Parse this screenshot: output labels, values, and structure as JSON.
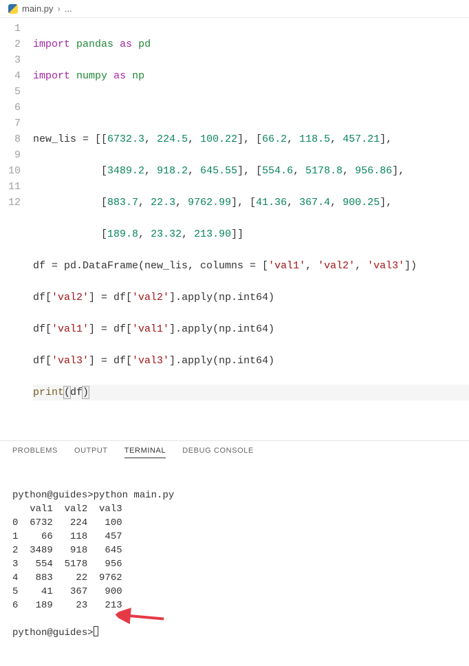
{
  "breadcrumb": {
    "file": "main.py",
    "more": "..."
  },
  "gutter_lines": [
    "1",
    "2",
    "3",
    "4",
    "5",
    "6",
    "7",
    "8",
    "9",
    "10",
    "11",
    "12"
  ],
  "code": {
    "l1": {
      "import": "import",
      "mod": "pandas",
      "as": "as",
      "alias": "pd"
    },
    "l2": {
      "import": "import",
      "mod": "numpy",
      "as": "as",
      "alias": "np"
    },
    "l4_a": "new_lis = [[",
    "l4_nums": [
      "6732.3",
      "224.5",
      "100.22"
    ],
    "l4_b": "], [",
    "l4_nums2": [
      "66.2",
      "118.5",
      "457.21"
    ],
    "l4_c": "],",
    "l5_a": "           [",
    "l5_nums": [
      "3489.2",
      "918.2",
      "645.55"
    ],
    "l5_b": "], [",
    "l5_nums2": [
      "554.6",
      "5178.8",
      "956.86"
    ],
    "l5_c": "],",
    "l6_a": "           [",
    "l6_nums": [
      "883.7",
      "22.3",
      "9762.99"
    ],
    "l6_b": "], [",
    "l6_nums2": [
      "41.36",
      "367.4",
      "900.25"
    ],
    "l6_c": "],",
    "l7_a": "           [",
    "l7_nums": [
      "189.8",
      "23.32",
      "213.90"
    ],
    "l7_b": "]]",
    "l8_a": "df = pd.DataFrame(new_lis, columns = [",
    "l8_strs": [
      "'val1'",
      "'val2'",
      "'val3'"
    ],
    "l8_b": "])",
    "l9_a": "df[",
    "l9_s1": "'val2'",
    "l9_b": "] = df[",
    "l9_s2": "'val2'",
    "l9_c": "].apply(np.int64)",
    "l10_a": "df[",
    "l10_s1": "'val1'",
    "l10_b": "] = df[",
    "l10_s2": "'val1'",
    "l10_c": "].apply(np.int64)",
    "l11_a": "df[",
    "l11_s1": "'val3'",
    "l11_b": "] = df[",
    "l11_s2": "'val3'",
    "l11_c": "].apply(np.int64)",
    "l12_print": "print",
    "l12_a": "(",
    "l12_df": "df",
    "l12_b": ")"
  },
  "panel_tabs": {
    "problems": "PROBLEMS",
    "output": "OUTPUT",
    "terminal": "TERMINAL",
    "debug": "DEBUG CONSOLE"
  },
  "terminal": {
    "prompt1": "python@guides>",
    "cmd": "python main.py",
    "header": "   val1  val2  val3",
    "rows": [
      "0  6732   224   100",
      "1    66   118   457",
      "2  3489   918   645",
      "3   554  5178   956",
      "4   883    22  9762",
      "5    41   367   900",
      "6   189    23   213"
    ],
    "prompt2": "python@guides>"
  },
  "chart_data": {
    "type": "table",
    "columns": [
      "val1",
      "val2",
      "val3"
    ],
    "index": [
      0,
      1,
      2,
      3,
      4,
      5,
      6
    ],
    "data": [
      [
        6732,
        224,
        100
      ],
      [
        66,
        118,
        457
      ],
      [
        3489,
        918,
        645
      ],
      [
        554,
        5178,
        956
      ],
      [
        883,
        22,
        9762
      ],
      [
        41,
        367,
        900
      ],
      [
        189,
        23,
        213
      ]
    ]
  }
}
